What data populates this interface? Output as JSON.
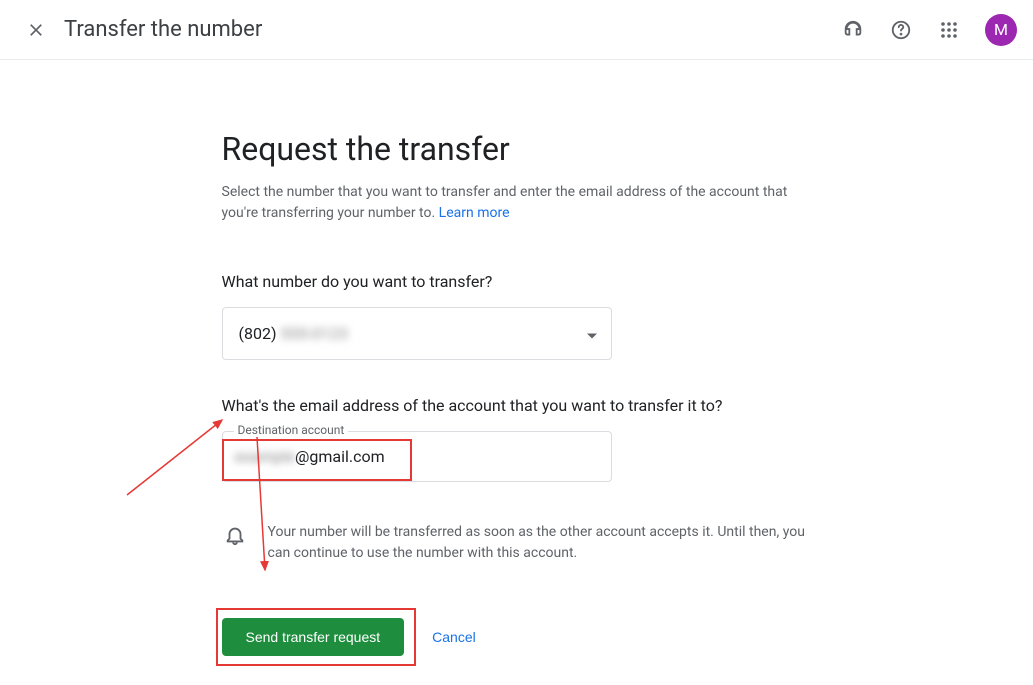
{
  "header": {
    "title": "Transfer the number",
    "avatar_letter": "M"
  },
  "main": {
    "heading": "Request the transfer",
    "description": "Select the number that you want to transfer and enter the email address of the account that you're transferring your number to.",
    "learn_more": "Learn more",
    "number_question": "What number do you want to transfer?",
    "number_prefix": "(802)",
    "number_rest": "555-0123",
    "email_question": "What's the email address of the account that you want to transfer it to?",
    "destination_label": "Destination account",
    "email_prefix": "example",
    "email_suffix": "@gmail.com",
    "info_text": "Your number will be transferred as soon as the other account accepts it. Until then, you can continue to use the number with this account.",
    "send_button": "Send transfer request",
    "cancel_button": "Cancel"
  }
}
